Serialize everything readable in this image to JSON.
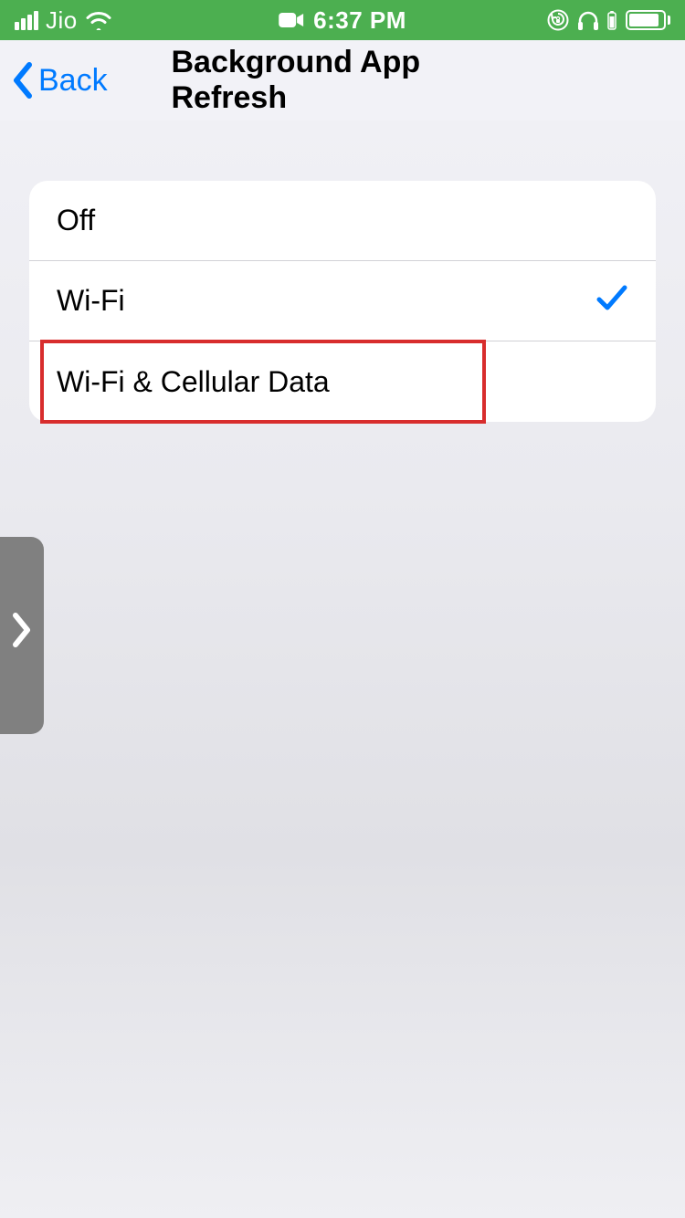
{
  "status_bar": {
    "carrier": "Jio",
    "time": "6:37 PM"
  },
  "nav": {
    "back_label": "Back",
    "title": "Background App Refresh"
  },
  "options": [
    {
      "label": "Off",
      "selected": false,
      "highlighted": false
    },
    {
      "label": "Wi-Fi",
      "selected": true,
      "highlighted": false
    },
    {
      "label": "Wi-Fi & Cellular Data",
      "selected": false,
      "highlighted": true
    }
  ]
}
